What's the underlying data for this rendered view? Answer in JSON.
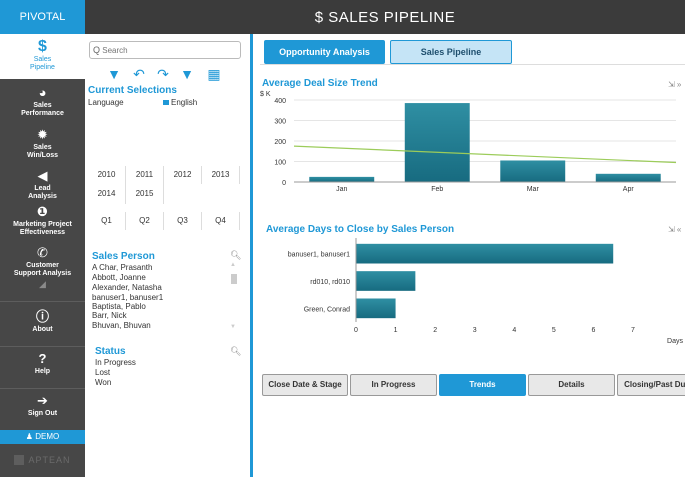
{
  "header": {
    "brand": "PIVOTAL",
    "title": "$  SALES PIPELINE"
  },
  "sidebar": {
    "items": [
      {
        "label": "Sales\nPipeline",
        "icon": "dollar-icon"
      },
      {
        "label": "Sales\nPerformance",
        "icon": "dashboard-icon"
      },
      {
        "label": "Sales\nWin/Loss",
        "icon": "badge-icon"
      },
      {
        "label": "Lead\nAnalysis",
        "icon": "megaphone-icon"
      },
      {
        "label": "Marketing Project\nEffectiveness",
        "icon": "info-circle-icon"
      },
      {
        "label": "Customer\nSupport Analysis",
        "icon": "phone-icon"
      },
      {
        "label": "About",
        "icon": "info-icon"
      },
      {
        "label": "Help",
        "icon": "question-icon"
      },
      {
        "label": "Sign Out",
        "icon": "sign-out-icon"
      }
    ],
    "demo": "DEMO",
    "footer_brand": "APTEAN"
  },
  "filter": {
    "search_placeholder": "Search",
    "current_selections_title": "Current Selections",
    "language_label": "Language",
    "language_value": "English",
    "years": [
      "2010",
      "2011",
      "2012",
      "2013",
      "2014",
      "2015"
    ],
    "quarters": [
      "Q1",
      "Q2",
      "Q3",
      "Q4"
    ],
    "sales_person_title": "Sales Person",
    "sales_persons": [
      "A Char, Prasanth",
      "Abbott, Joanne",
      "Alexander, Natasha",
      "banuser1, banuser1",
      "Baptista, Pablo",
      "Barr, Nick",
      "Bhuvan, Bhuvan"
    ],
    "status_title": "Status",
    "statuses": [
      "In Progress",
      "Lost",
      "Won"
    ]
  },
  "tabs": {
    "opportunity": "Opportunity Analysis",
    "pipeline": "Sales Pipeline"
  },
  "chart1": {
    "title": "Average Deal Size Trend",
    "unit": "$ K",
    "tools": "⇲ »"
  },
  "chart2": {
    "title": "Average Days to Close by Sales Person",
    "xunit": "Days",
    "tools": "⇲ «"
  },
  "bottom_tabs": [
    "Close Date & Stage",
    "In Progress",
    "Trends",
    "Details",
    "Closing/Past Due"
  ],
  "chart_data": [
    {
      "type": "bar",
      "title": "Average Deal Size Trend",
      "ylabel": "$ K",
      "categories": [
        "Jan",
        "Feb",
        "Mar",
        "Apr"
      ],
      "values": [
        25,
        385,
        105,
        40
      ],
      "ylim": [
        0,
        400
      ],
      "yticks": [
        0,
        100,
        200,
        300,
        400
      ],
      "trendline": [
        175,
        95
      ]
    },
    {
      "type": "bar",
      "orientation": "horizontal",
      "title": "Average Days to Close by Sales Person",
      "xlabel": "Days",
      "categories": [
        "banuser1, banuser1",
        "rd010, rd010",
        "Green, Conrad"
      ],
      "values": [
        6.5,
        1.5,
        1.0
      ],
      "xlim": [
        0,
        7
      ],
      "xticks": [
        0,
        1,
        2,
        3,
        4,
        5,
        6,
        7
      ]
    }
  ]
}
